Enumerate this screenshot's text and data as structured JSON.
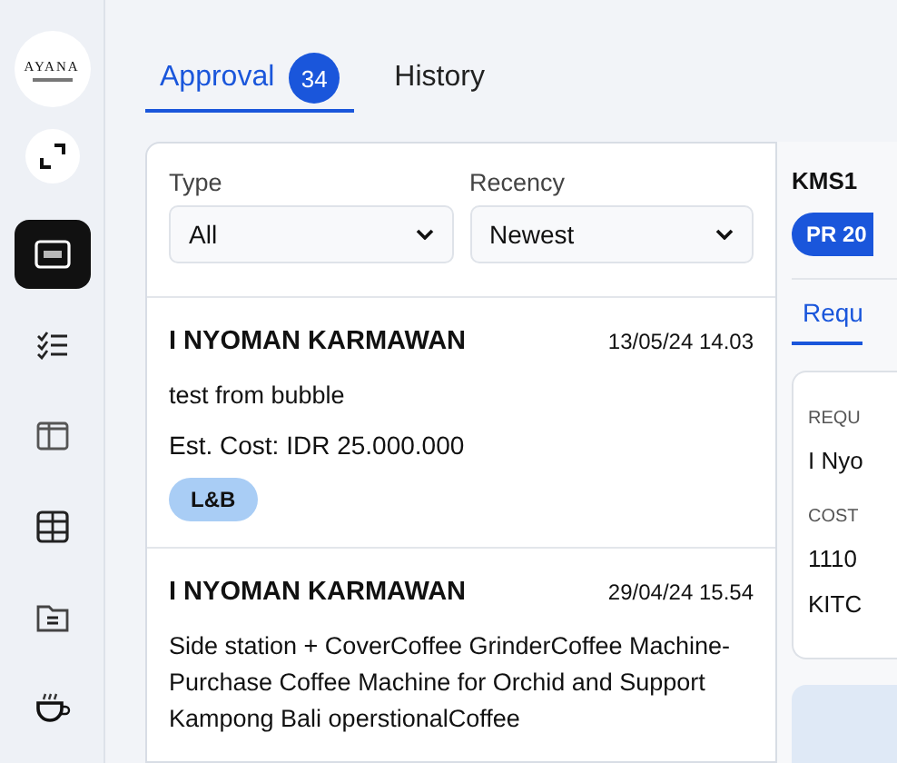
{
  "sidebar": {
    "logo": {
      "name": "AYANA"
    },
    "items": [
      {
        "kind": "expand",
        "selected": false
      },
      {
        "kind": "monitor",
        "selected": true
      },
      {
        "kind": "checklist",
        "selected": false
      },
      {
        "kind": "columns",
        "selected": false
      },
      {
        "kind": "grid",
        "selected": false
      },
      {
        "kind": "folder",
        "selected": false
      },
      {
        "kind": "cup",
        "selected": false
      }
    ]
  },
  "tabs": [
    {
      "label": "Approval",
      "count": "34",
      "selected": true
    },
    {
      "label": "History",
      "selected": false
    }
  ],
  "filters": [
    {
      "label": "Type",
      "value": "All"
    },
    {
      "label": "Recency",
      "value": "Newest"
    }
  ],
  "requests": [
    {
      "requester": "I NYOMAN KARMAWAN",
      "date": "13/05/24 14.03",
      "description": "test from bubble",
      "cost": "Est. Cost: IDR 25.000.000",
      "tag": "L&B"
    },
    {
      "requester": "I NYOMAN KARMAWAN",
      "date": "29/04/24 15.54",
      "description": "Side station + CoverCoffee GrinderCoffee Machine-Purchase Coffee Machine for Orchid and Support Kampong Bali operstionalCoffee"
    }
  ],
  "detail": {
    "code": "KMS1",
    "pr_number": "PR 20",
    "tab": "Requ",
    "fields": [
      {
        "label": "REQU",
        "lines": [
          "I Nyo"
        ]
      },
      {
        "label": "COST",
        "lines": [
          "1110",
          "KITC"
        ]
      }
    ]
  }
}
